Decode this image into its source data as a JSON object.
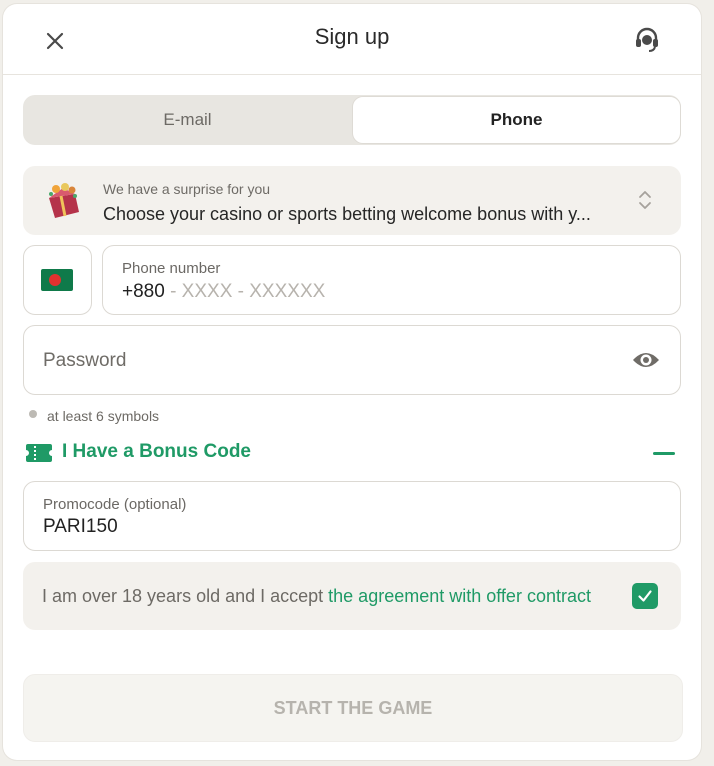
{
  "header": {
    "title": "Sign up",
    "close_icon": "close-icon",
    "support_icon": "headset-icon"
  },
  "tabs": [
    {
      "label": "E-mail",
      "active": false
    },
    {
      "label": "Phone",
      "active": true
    }
  ],
  "bonus": {
    "small": "We have a surprise for you",
    "main": "Choose your casino or sports betting welcome bonus with y...",
    "icon": "gift-icon"
  },
  "phone": {
    "flag": "bangladesh-flag",
    "label": "Phone number",
    "code": "+880",
    "mask": " - XXXX - XXXXXX"
  },
  "password": {
    "placeholder": "Password",
    "icon": "eye-icon"
  },
  "hint": "at least 6 symbols",
  "bonus_code": {
    "label": "I Have a Bonus Code",
    "expanded": true
  },
  "promo": {
    "label": "Promocode (optional)",
    "value": "PARI150"
  },
  "agreement": {
    "text": "I am over 18 years old and I accept ",
    "link": "the agreement with offer contract",
    "checked": true
  },
  "start_button": "START THE GAME",
  "colors": {
    "accent": "#1f9a66",
    "background": "#f1efea",
    "card": "#f3f1ed"
  }
}
